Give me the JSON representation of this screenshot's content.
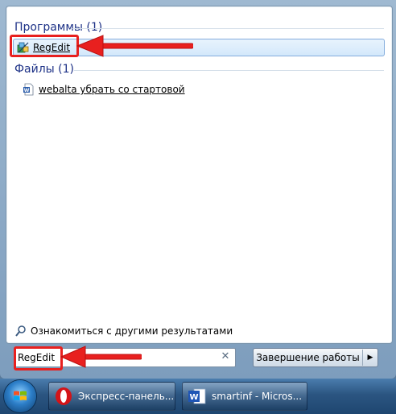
{
  "results": {
    "programs_header": "Программы (1)",
    "programs": [
      {
        "label": "RegEdit",
        "icon": "regedit-icon"
      }
    ],
    "files_header": "Файлы (1)",
    "files": [
      {
        "label": "webalta убрать со стартовой",
        "icon": "word-document-icon"
      }
    ],
    "more_results": "Ознакомиться с другими результатами"
  },
  "search": {
    "value": "RegEdit",
    "clear_icon": "close-icon"
  },
  "shutdown": {
    "label": "Завершение работы"
  },
  "taskbar": {
    "items": [
      {
        "label": "Экспресс-панель...",
        "icon": "opera-icon"
      },
      {
        "label": "smartinf - Micros...",
        "icon": "word-icon"
      }
    ]
  },
  "colors": {
    "accent": "#1e3287",
    "annotation": "#e8201f",
    "taskbar": "#2b5581"
  }
}
